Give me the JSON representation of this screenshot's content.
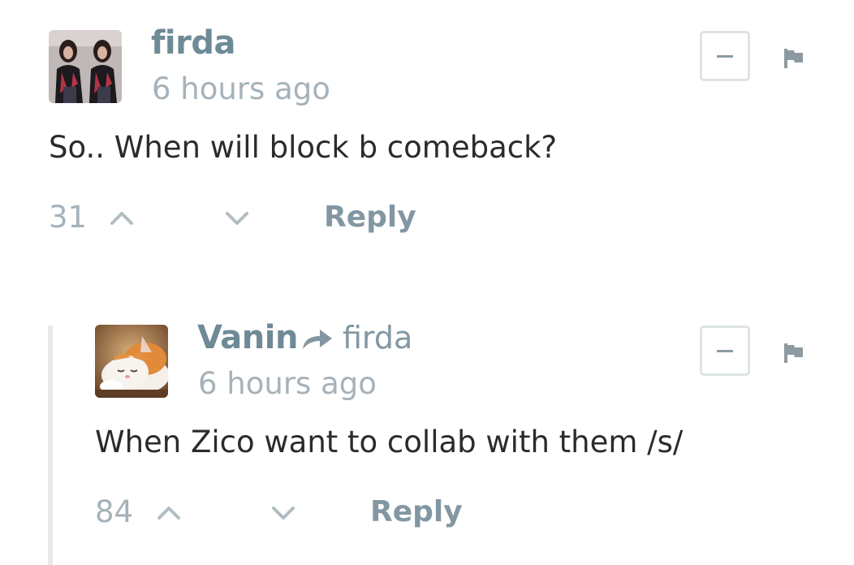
{
  "comments": [
    {
      "author": "firda",
      "time": "6 hours ago",
      "text": "So.. When will block b comeback?",
      "upvotes": "31",
      "reply_label": "Reply",
      "avatar_icon": "user-photo-avatar"
    },
    {
      "author": "Vanin",
      "in_reply_to": "firda",
      "time": "6 hours ago",
      "text": "When Zico want to collab with them /s/",
      "upvotes": "84",
      "reply_label": "Reply",
      "avatar_icon": "sleeping-cat-avatar"
    }
  ],
  "colors": {
    "author": "#6e8a96",
    "meta": "#a6b2ba",
    "text": "#2b2b2b",
    "border": "#dde3e6"
  }
}
